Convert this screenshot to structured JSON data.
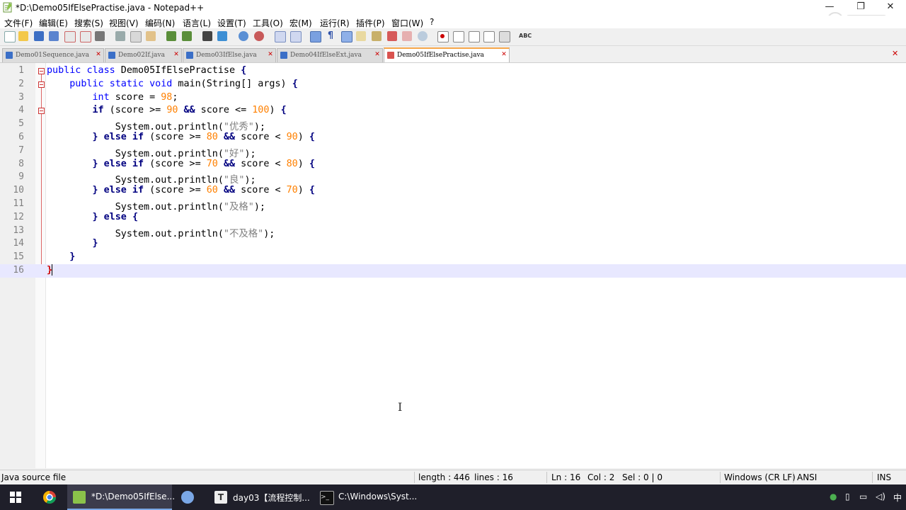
{
  "window": {
    "title": "*D:\\Demo05IfElsePractise.java - Notepad++",
    "minimize": "—",
    "restore": "❐",
    "close": "✕",
    "extra": "XC"
  },
  "menu": [
    "文件(F)",
    "编辑(E)",
    "搜索(S)",
    "视图(V)",
    "编码(N)",
    "语言(L)",
    "设置(T)",
    "工具(O)",
    "宏(M)",
    "运行(R)",
    "插件(P)",
    "窗口(W)",
    "?"
  ],
  "toolbar": {
    "spell_label": "ABC"
  },
  "tabs": [
    {
      "label": "Demo01Sequence.java",
      "active": false
    },
    {
      "label": "Demo02If.java",
      "active": false
    },
    {
      "label": "Demo03IfElse.java",
      "active": false
    },
    {
      "label": "Demo04IfElseExt.java",
      "active": false
    },
    {
      "label": "Demo05IfElsePractise.java",
      "active": true
    }
  ],
  "editor": {
    "line_numbers": [
      "1",
      "2",
      "3",
      "4",
      "5",
      "6",
      "7",
      "8",
      "9",
      "10",
      "11",
      "12",
      "13",
      "14",
      "15",
      "16"
    ],
    "current_line": 16
  },
  "status": {
    "filetype": "Java source file",
    "length": "length : 446",
    "lines": "lines : 16",
    "ln": "Ln : 16",
    "col": "Col : 2",
    "sel": "Sel : 0 | 0",
    "eol": "Windows (CR LF)",
    "encoding": "ANSI",
    "mode": "INS"
  },
  "taskbar": {
    "items": [
      {
        "label": "*D:\\Demo05IfElse...",
        "icon": "notepad-plus-plus-icon",
        "active": true
      },
      {
        "label": "",
        "icon": "paint-palette-icon",
        "active": false
      },
      {
        "label": "day03【流程控制...",
        "icon": "typora-icon",
        "active": false
      },
      {
        "label": "C:\\Windows\\Syst...",
        "icon": "console-icon",
        "active": false
      }
    ],
    "ime": "中"
  },
  "colors": {
    "keyword": "#0000ff",
    "control": "#000080",
    "number": "#ff8000",
    "string": "#808080",
    "current_line": "#e8e8ff"
  }
}
